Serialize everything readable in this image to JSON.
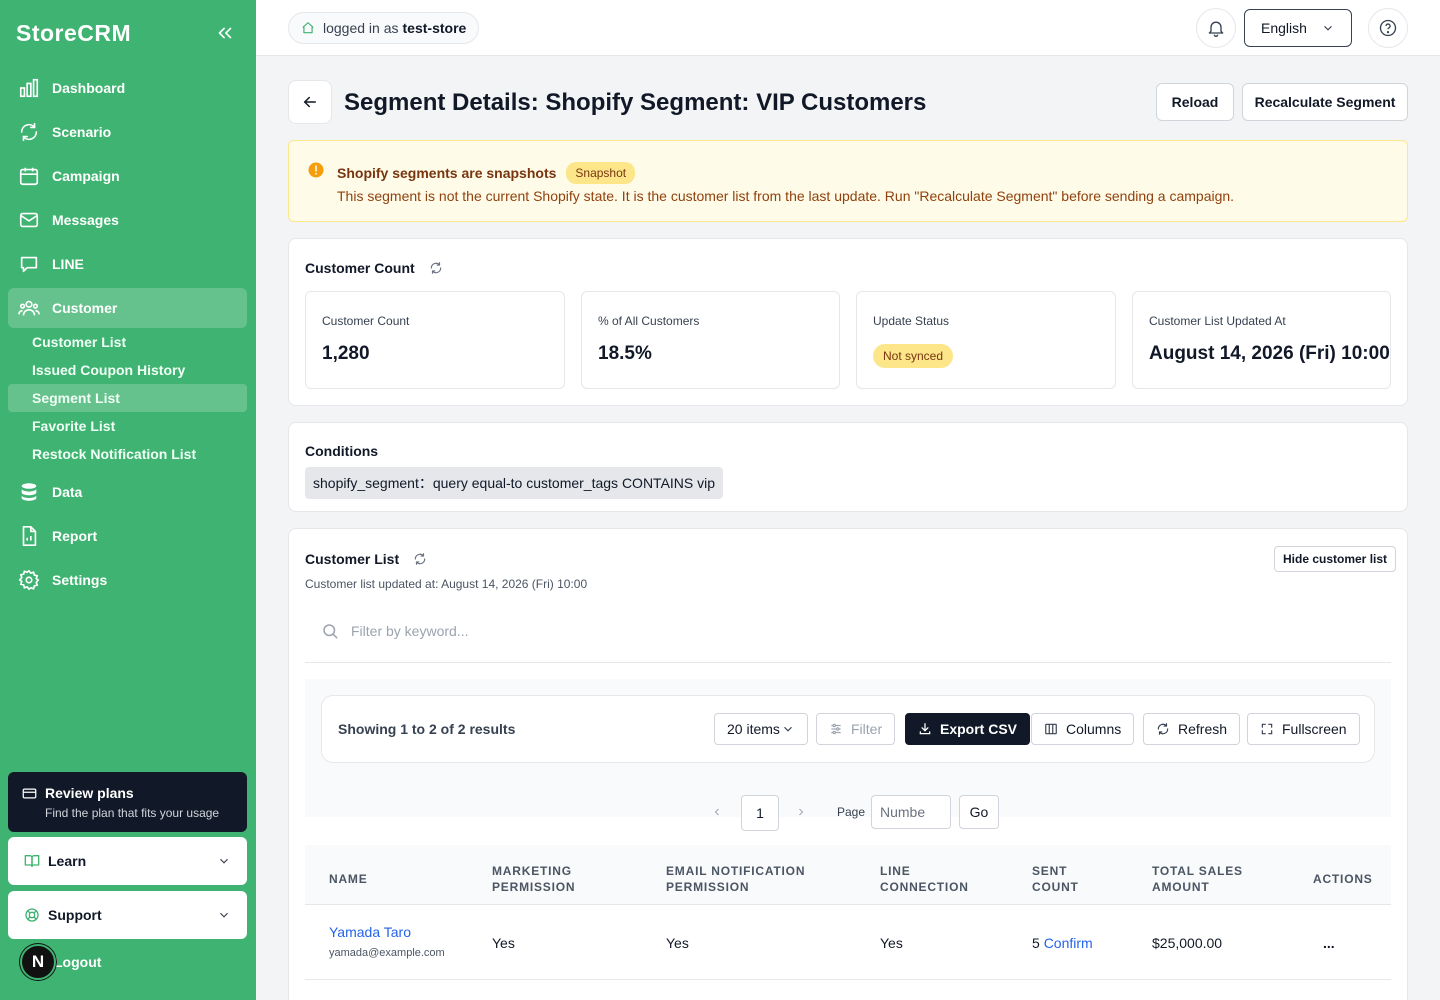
{
  "app": {
    "brand": "StoreCRM"
  },
  "sidebar": {
    "items": [
      {
        "label": "Dashboard",
        "icon": "bar-chart-icon"
      },
      {
        "label": "Scenario",
        "icon": "repeat-icon"
      },
      {
        "label": "Campaign",
        "icon": "calendar-icon"
      },
      {
        "label": "Messages",
        "icon": "mail-icon"
      },
      {
        "label": "LINE",
        "icon": "chat-icon"
      },
      {
        "label": "Customer",
        "icon": "users-icon"
      },
      {
        "label": "Data",
        "icon": "database-icon"
      },
      {
        "label": "Report",
        "icon": "file-chart-icon"
      },
      {
        "label": "Settings",
        "icon": "gear-icon"
      }
    ],
    "sub_items": [
      {
        "label": "Customer List"
      },
      {
        "label": "Issued Coupon History"
      },
      {
        "label": "Segment List"
      },
      {
        "label": "Favorite List"
      },
      {
        "label": "Restock Notification List"
      }
    ],
    "plans": {
      "title": "Review plans",
      "subtitle": "Find the plan that fits your usage"
    },
    "learn": "Learn",
    "support": "Support",
    "logout": "Logout",
    "avatar_initial": "N"
  },
  "topbar": {
    "login_prefix": "logged in as",
    "user": "test-store",
    "language": "English"
  },
  "page": {
    "title": "Segment Details: Shopify Segment: VIP Customers",
    "reload": "Reload",
    "recalculate": "Recalculate Segment"
  },
  "alert": {
    "title": "Shopify segments are snapshots",
    "badge": "Snapshot",
    "description": "This segment is not the current Shopify state. It is the customer list from the last update. Run \"Recalculate Segment\" before sending a campaign."
  },
  "count_card": {
    "title": "Customer Count",
    "stats": [
      {
        "label": "Customer Count",
        "value": "1,280"
      },
      {
        "label": "% of All Customers",
        "value": "18.5%"
      },
      {
        "label": "Update Status",
        "value": "Not synced"
      },
      {
        "label": "Customer List Updated At",
        "value": "August 14, 2026 (Fri) 10:00"
      }
    ]
  },
  "conditions": {
    "title": "Conditions",
    "chip": "shopify_segment：query equal-to customer_tags CONTAINS vip"
  },
  "customer_list": {
    "title": "Customer List",
    "hide_button": "Hide customer list",
    "updated_at": "Customer list updated at: August 14, 2026 (Fri) 10:00",
    "search_placeholder": "Filter by keyword...",
    "results_text": "Showing 1 to 2 of 2 results",
    "page_size": "20 items",
    "filter": "Filter",
    "export": "Export CSV",
    "columns": "Columns",
    "refresh": "Refresh",
    "fullscreen": "Fullscreen",
    "current_page": "1",
    "page_label": "Page",
    "page_input_placeholder": "Numbe",
    "go": "Go",
    "headers": {
      "name": "NAME",
      "marketing_1": "MARKETING",
      "marketing_2": "PERMISSION",
      "email_1": "EMAIL NOTIFICATION",
      "email_2": "PERMISSION",
      "line_1": "LINE",
      "line_2": "CONNECTION",
      "sent_1": "SENT",
      "sent_2": "COUNT",
      "sales_1": "TOTAL SALES",
      "sales_2": "AMOUNT",
      "actions": "ACTIONS"
    },
    "rows": [
      {
        "name": "Yamada Taro",
        "email": "yamada@example.com",
        "marketing": "Yes",
        "email_permission": "Yes",
        "line": "Yes",
        "sent_count": "5",
        "sent_link": "Confirm",
        "sales": "$25,000.00",
        "actions": "..."
      }
    ]
  }
}
